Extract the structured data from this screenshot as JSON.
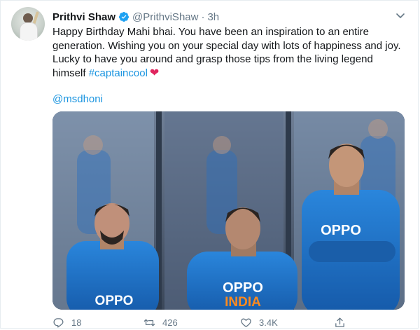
{
  "tweet": {
    "author_name": "Prithvi Shaw",
    "handle": "@PrithviShaw",
    "separator": "·",
    "time": "3h",
    "lines": [
      "Happy Birthday Mahi bhai. You have been an inspiration to an entire",
      "generation. Wishing you on your special day with lots of happiness and joy.",
      "Lucky to have you around and grasp those tips from the living legend"
    ],
    "last_line_text": "himself",
    "hashtag": "#captaincool",
    "heart": "❤",
    "mention": "@msdhoni"
  },
  "photo": {
    "jersey_brand": "OPPO",
    "jersey_country": "INDIA",
    "jersey_color": "#1e73c8"
  },
  "actions": {
    "replies": "18",
    "retweets": "426",
    "likes": "3.4K"
  },
  "icons": {
    "verified": "verified-badge-icon",
    "more": "chevron-down-icon",
    "reply": "reply-icon",
    "retweet": "retweet-icon",
    "like": "heart-icon",
    "share": "share-icon"
  },
  "colors": {
    "link": "#1b95e0",
    "heart": "#e0245e",
    "muted": "#657786",
    "verified": "#1da1f2"
  }
}
